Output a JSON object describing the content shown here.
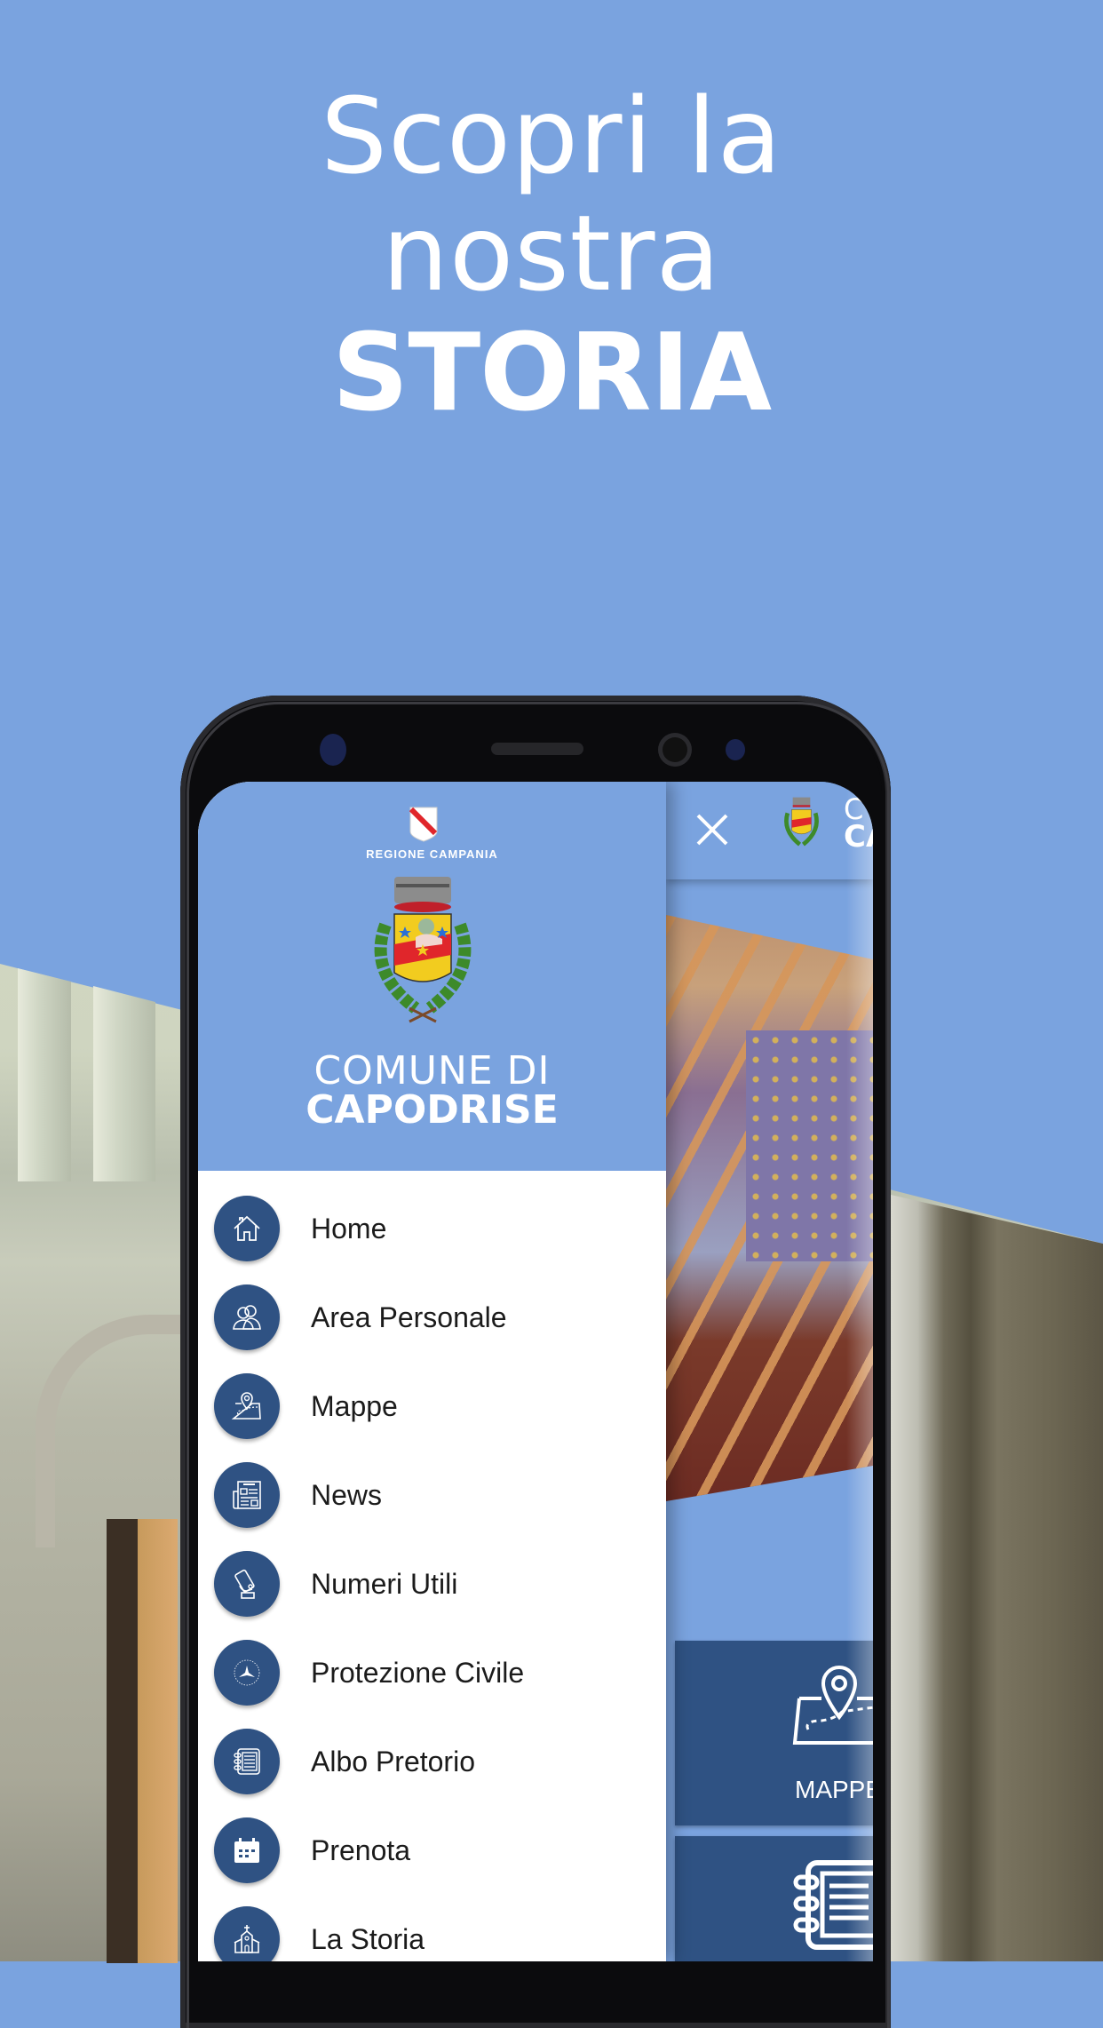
{
  "promo": {
    "headline_line1": "Scopri la",
    "headline_line2": "nostra",
    "headline_line3": "STORIA"
  },
  "colors": {
    "background": "#7aa3df",
    "menu_icon_bg": "#2f5283",
    "text_dark": "#1b1b1b",
    "white": "#ffffff"
  },
  "drawer": {
    "region_label": "REGIONE CAMPANIA",
    "comune_line1": "COMUNE DI",
    "comune_line2": "CAPODRISE",
    "items": [
      {
        "label": "Home",
        "icon": "home-icon"
      },
      {
        "label": "Area Personale",
        "icon": "users-icon"
      },
      {
        "label": "Mappe",
        "icon": "map-pin-icon"
      },
      {
        "label": "News",
        "icon": "newspaper-icon"
      },
      {
        "label": "Numeri Utili",
        "icon": "phone-hand-icon"
      },
      {
        "label": "Protezione Civile",
        "icon": "protezione-civile-icon"
      },
      {
        "label": "Albo Pretorio",
        "icon": "notebook-icon"
      },
      {
        "label": "Prenota",
        "icon": "calendar-icon"
      },
      {
        "label": "La Storia",
        "icon": "church-icon"
      }
    ]
  },
  "app": {
    "close_icon": "close-icon",
    "title_line1": "C",
    "title_line2": "CA",
    "tiles": [
      {
        "label": "MAPPE",
        "icon": "map-pin-icon"
      },
      {
        "label": "",
        "icon": "notebook-icon"
      }
    ]
  }
}
